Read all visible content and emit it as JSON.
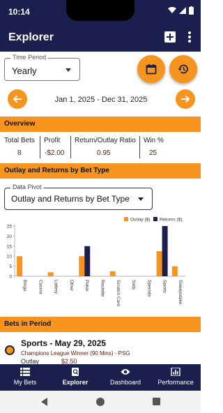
{
  "status_bar": {
    "time": "10:14"
  },
  "app_bar": {
    "title": "Explorer"
  },
  "period": {
    "label": "Time Period",
    "value": "Yearly"
  },
  "date_range": "Jan 1, 2025 - Dec 31, 2025",
  "overview": {
    "header": "Overview",
    "stats": [
      {
        "label": "Total Bets",
        "value": "8"
      },
      {
        "label": "Profit",
        "value": "-$2.00"
      },
      {
        "label": "Return/Outlay Ratio",
        "value": "0.95"
      },
      {
        "label": "Win %",
        "value": "25"
      }
    ]
  },
  "outlay_section": {
    "header": "Outlay and Returns by Bet Type"
  },
  "pivot": {
    "label": "Data Pivot",
    "value": "Outlay and Returns by Bet Type"
  },
  "chart_data": {
    "type": "bar",
    "categories": [
      "Bingo",
      "Casino",
      "Lottery",
      "Other",
      "Poker",
      "Roulette",
      "Scratch Card",
      "Slots",
      "Specials",
      "Sports",
      "Sweepstake"
    ],
    "series": [
      {
        "name": "Outlay ($)",
        "color": "#f7941d",
        "values": [
          10,
          0,
          2,
          0,
          10,
          0,
          2.5,
          0,
          0,
          12.5,
          5
        ]
      },
      {
        "name": "Returns ($)",
        "color": "#1a1f4d",
        "values": [
          0,
          0,
          0,
          0,
          15,
          0,
          0,
          0,
          0,
          25,
          0
        ]
      }
    ],
    "yticks": [
      0,
      5,
      10,
      15,
      20,
      25
    ],
    "ylim": [
      0,
      25
    ],
    "legend_position": "top-right"
  },
  "bets_section": {
    "header": "Bets in Period"
  },
  "bet": {
    "title": "Sports - May 29, 2025",
    "description": "Champions League Winner (90 Mins) - PSG",
    "outlay_label": "Outlay",
    "outlay_value": "$2.50"
  },
  "bottom_nav": {
    "items": [
      {
        "label": "My Bets",
        "icon": "list-icon"
      },
      {
        "label": "Explorer",
        "icon": "search-doc-icon"
      },
      {
        "label": "Dashboard",
        "icon": "eye-icon"
      },
      {
        "label": "Performance",
        "icon": "bar-chart-icon"
      }
    ]
  },
  "colors": {
    "primary": "#1a1f4d",
    "accent": "#f7941d",
    "value_text": "#5a1a0a"
  }
}
